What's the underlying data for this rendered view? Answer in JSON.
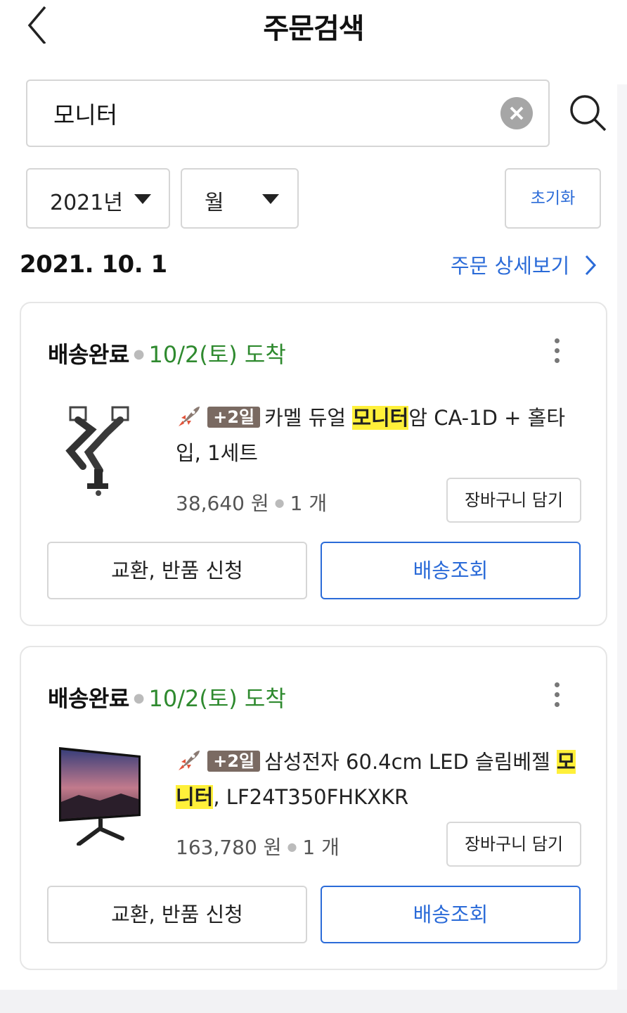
{
  "header": {
    "title": "주문검색"
  },
  "search": {
    "value": "모니터"
  },
  "filters": {
    "year": "2021년",
    "month": "월",
    "reset_label": "초기화"
  },
  "order": {
    "date": "2021. 10. 1",
    "detail_link": "주문 상세보기"
  },
  "items": [
    {
      "status": "배송완료",
      "arrival": "10/2(토) 도착",
      "badge": "+2일",
      "name_before": "카멜 듀얼 ",
      "name_highlight": "모니터",
      "name_after": "암 CA-1D + 홀타입, 1세트",
      "price": "38,640 원",
      "qty": "1 개",
      "cart_label": "장바구니 담기",
      "exchange_label": "교환, 반품 신청",
      "track_label": "배송조회",
      "thumb_icon": "monitor-arm-image"
    },
    {
      "status": "배송완료",
      "arrival": "10/2(토) 도착",
      "badge": "+2일",
      "name_before": "삼성전자 60.4cm LED 슬림베젤 ",
      "name_highlight": "모니터",
      "name_after": ", LF24T350FHKXKR",
      "price": "163,780 원",
      "qty": "1 개",
      "cart_label": "장바구니 담기",
      "exchange_label": "교환, 반품 신청",
      "track_label": "배송조회",
      "thumb_icon": "monitor-image"
    }
  ],
  "colors": {
    "accent": "#2b6bd8",
    "arrival": "#2f8a2f",
    "highlight": "#fff03a",
    "badge": "#7a6a62"
  }
}
